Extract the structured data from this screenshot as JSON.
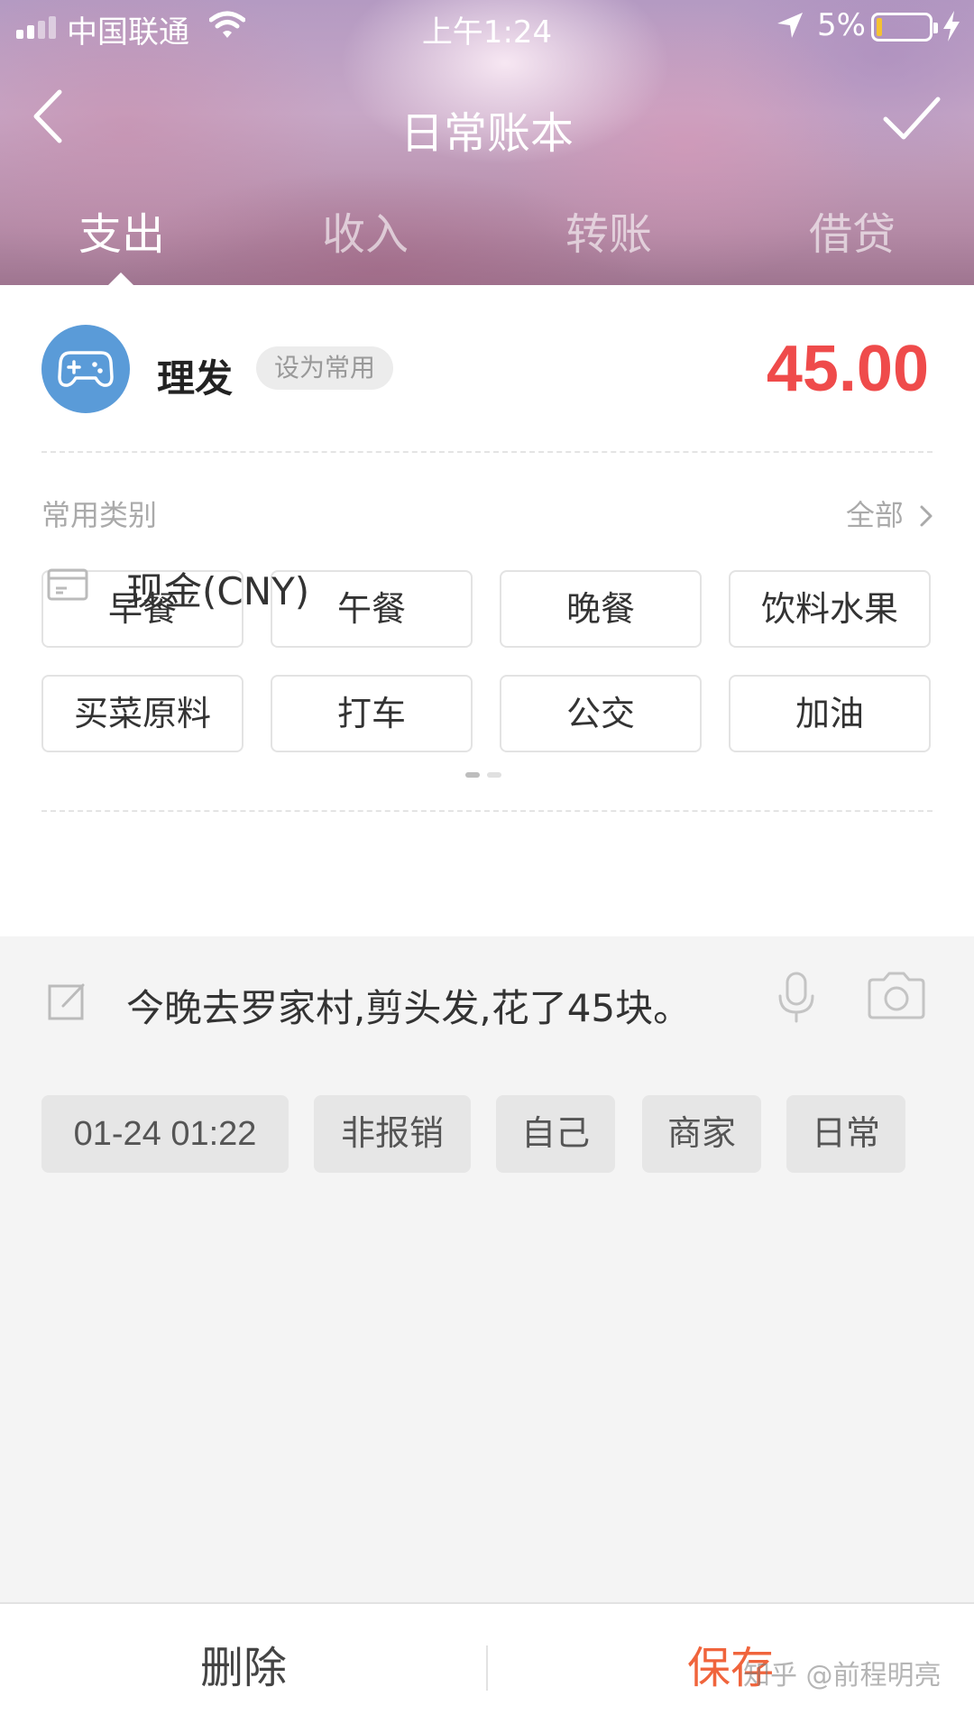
{
  "status_bar": {
    "carrier": "中国联通",
    "time": "上午1:24",
    "battery_percent": "5%"
  },
  "nav": {
    "title": "日常账本"
  },
  "tabs": [
    {
      "label": "支出",
      "active": true
    },
    {
      "label": "收入",
      "active": false
    },
    {
      "label": "转账",
      "active": false
    },
    {
      "label": "借贷",
      "active": false
    }
  ],
  "category": {
    "icon": "gamepad-icon",
    "icon_color": "#5a9bd8",
    "name": "理发",
    "set_common_label": "设为常用",
    "amount": "45.00",
    "amount_color": "#ef4b4b"
  },
  "common_categories": {
    "label": "常用类别",
    "all_link": "全部",
    "items": [
      "早餐",
      "午餐",
      "晚餐",
      "饮料水果",
      "买菜原料",
      "打车",
      "公交",
      "加油"
    ],
    "page": 1,
    "page_count": 2
  },
  "account": {
    "icon": "card-icon",
    "label": "现金(CNY)"
  },
  "note": {
    "icon": "edit-icon",
    "text": "今晚去罗家村,剪头发,花了45块。"
  },
  "tags": [
    "01-24 01:22",
    "非报销",
    "自己",
    "商家",
    "日常"
  ],
  "bottom": {
    "delete_label": "删除",
    "save_label": "保存",
    "save_color": "#f0643c"
  },
  "watermark": "知乎 @前程明亮"
}
